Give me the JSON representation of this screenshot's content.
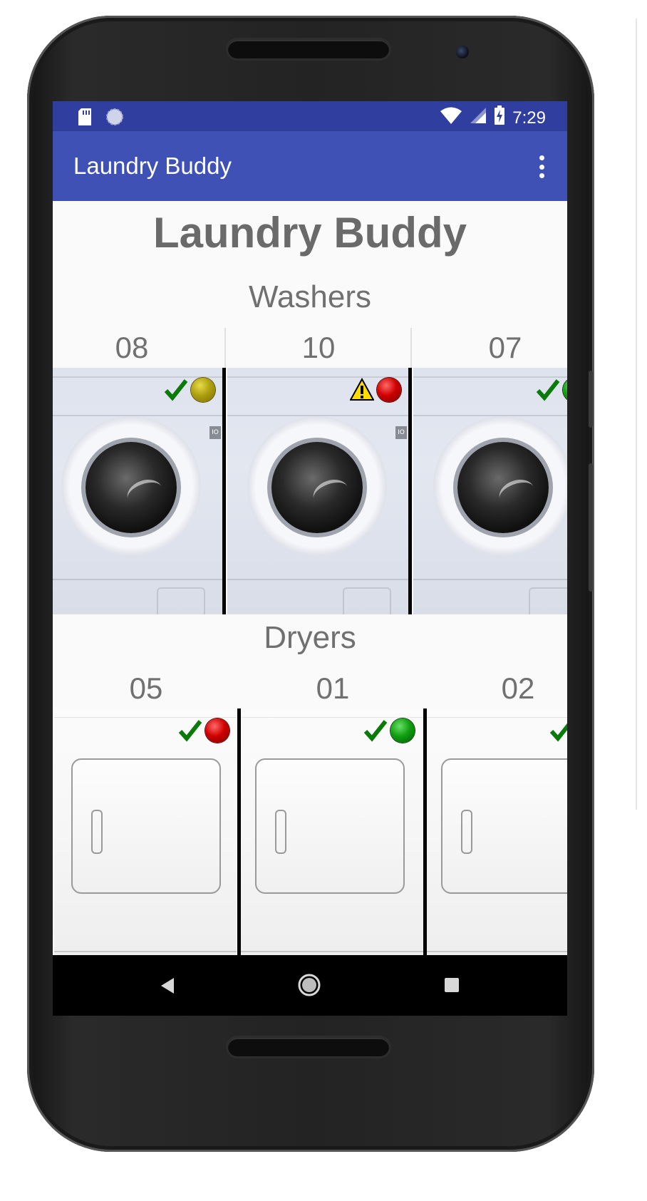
{
  "status_bar": {
    "time": "7:29",
    "left_icons": [
      "sd-card-icon",
      "sync-icon"
    ],
    "right_icons": [
      "wifi-icon",
      "cell-signal-icon",
      "battery-charging-icon"
    ]
  },
  "app_bar": {
    "title": "Laundry Buddy",
    "menu_icon": "more-vert-icon"
  },
  "main": {
    "heading": "Laundry Buddy",
    "washers": {
      "title": "Washers",
      "machines": [
        {
          "number": "08",
          "indicators": [
            "check",
            "yellow-light"
          ]
        },
        {
          "number": "10",
          "indicators": [
            "warning",
            "red-light"
          ]
        },
        {
          "number": "07",
          "indicators": [
            "check",
            "green-light"
          ]
        }
      ]
    },
    "dryers": {
      "title": "Dryers",
      "machines": [
        {
          "number": "05",
          "indicators": [
            "check",
            "red-light"
          ]
        },
        {
          "number": "01",
          "indicators": [
            "check",
            "green-light"
          ]
        },
        {
          "number": "02",
          "indicators": [
            "check"
          ]
        }
      ]
    }
  },
  "nav_bar": {
    "buttons": [
      "back-icon",
      "home-icon",
      "recents-icon"
    ]
  },
  "colors": {
    "status_bar": "#303f9f",
    "app_bar": "#3f51b5",
    "check": "#0a7a0a",
    "warning_yellow": "#ffdd00"
  }
}
